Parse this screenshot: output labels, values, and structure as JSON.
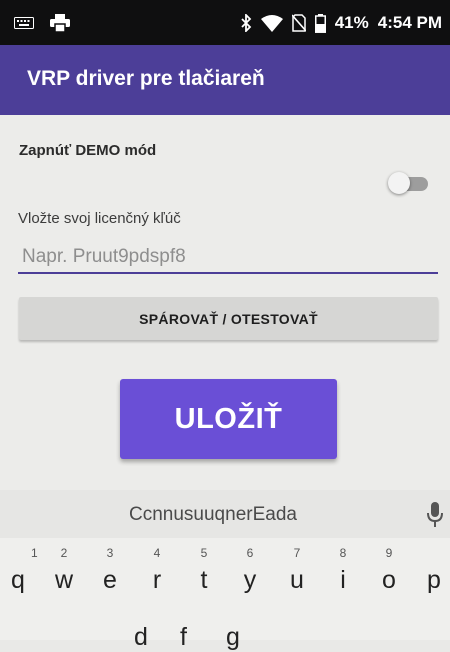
{
  "status_bar": {
    "battery": "41%",
    "time": "4:54 PM",
    "left_icons": [
      "keyboard-icon",
      "printer-icon"
    ],
    "right_icons": [
      "bluetooth-icon",
      "wifi-icon",
      "no-sim-icon",
      "battery-icon"
    ]
  },
  "app_bar": {
    "title": "VRP driver pre tlačiareň"
  },
  "form": {
    "demo_label": "Zapnúť DEMO mód",
    "demo_enabled": false,
    "license_label": "Vložte svoj licenčný kľúč",
    "license_placeholder": "Napr. Pruut9pdspf8",
    "license_value": "",
    "pair_button": "SPÁROVAŤ / OTESTOVAŤ",
    "save_button": "ULOŽIŤ"
  },
  "keyboard": {
    "suggestion": "CcnnusuuqnerEada",
    "row1_hints": [
      "1",
      "2",
      "3",
      "4",
      "5",
      "6",
      "7",
      "8",
      "9"
    ],
    "row1_keys": [
      "q",
      "w",
      "e",
      "r",
      "t",
      "y",
      "u",
      "i",
      "o",
      "p"
    ],
    "row2_visible": [
      "d",
      "f",
      "g"
    ]
  },
  "colors": {
    "app_bar": "#4c3e98",
    "accent_button": "#6a4fd6",
    "status_bar": "#0f0f10"
  }
}
